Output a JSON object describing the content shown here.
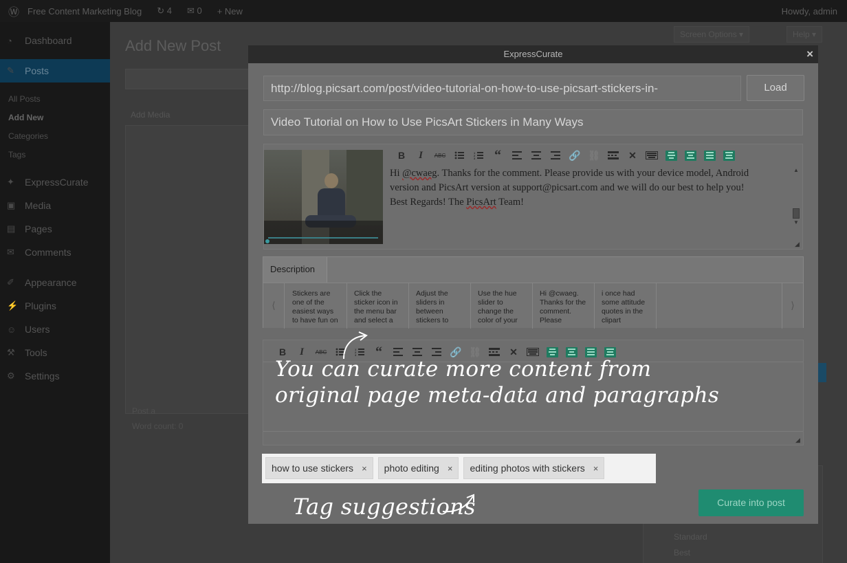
{
  "admin_bar": {
    "wp_logo_icon": "wordpress-logo",
    "site_name": "Free Content Marketing Blog",
    "updates_count": "4",
    "comments_count": "0",
    "new_label": "New",
    "account": "Howdy, admin"
  },
  "sidebar": {
    "items": [
      {
        "icon": "dashboard-icon",
        "label": "Dashboard"
      },
      {
        "icon": "pin-icon",
        "label": "Posts"
      },
      {
        "label": "All Posts"
      },
      {
        "label": "Add New"
      },
      {
        "label": "Categories"
      },
      {
        "label": "Tags"
      },
      {
        "icon": "expresscurate-icon",
        "label": "ExpressCurate"
      },
      {
        "icon": "media-icon",
        "label": "Media"
      },
      {
        "icon": "pages-icon",
        "label": "Pages"
      },
      {
        "icon": "comments-icon",
        "label": "Comments"
      },
      {
        "icon": "appearance-icon",
        "label": "Appearance"
      },
      {
        "icon": "plugins-icon",
        "label": "Plugins"
      },
      {
        "icon": "users-icon",
        "label": "Users"
      },
      {
        "icon": "tools-icon",
        "label": "Tools"
      },
      {
        "icon": "settings-icon",
        "label": "Settings"
      }
    ]
  },
  "wp_page": {
    "title": "Add New Post",
    "screen_options": "Screen Options ▾",
    "help": "Help ▾",
    "add_media": "Add Media",
    "word_count": "Word count: 0",
    "draft_saved": "Post a",
    "side_labels": [
      "Standard",
      "Best"
    ]
  },
  "modal": {
    "title": "ExpressCurate",
    "url_value": "http://blog.picsart.com/post/video-tutorial-on-how-to-use-picsart-stickers-in-",
    "load_label": "Load",
    "title_value": "Video Tutorial on How to Use PicsArt Stickers in Many Ways",
    "editor_text": {
      "line1_a": "Hi ",
      "line1_handle": "@cwaeg",
      "line1_b": ". Thanks for the comment. Please provide us with your device model, Android",
      "line2": "version and PicsArt version at support@picsart.com and we will do our best to help you!",
      "line3_a": "Best Regards! The ",
      "line3_brand": "PicsArt",
      "line3_b": " Team!"
    },
    "description_tab": "Description",
    "snippets": [
      "Stickers are one of the easiest ways to have fun on",
      "Click the sticker icon in the menu bar and select a",
      "Adjust the sliders in between stickers to",
      "Use the hue slider to change the color of your",
      "Hi @cwaeg. Thanks for the comment. Please",
      "i once had some attitude quotes in the clipart"
    ],
    "tags": [
      "how to use stickers",
      "photo editing",
      "editing photos with stickers"
    ],
    "tag_remove_glyph": "×",
    "curate_button": "Curate into post"
  },
  "annotations": {
    "curate_more_line1": "You can curate more content from",
    "curate_more_line2": "original page meta-data and paragraphs",
    "tag_suggestions": "Tag suggestions"
  },
  "colors": {
    "accent_green": "#1f8c71",
    "overlay_dark": "#3a3a3a"
  }
}
